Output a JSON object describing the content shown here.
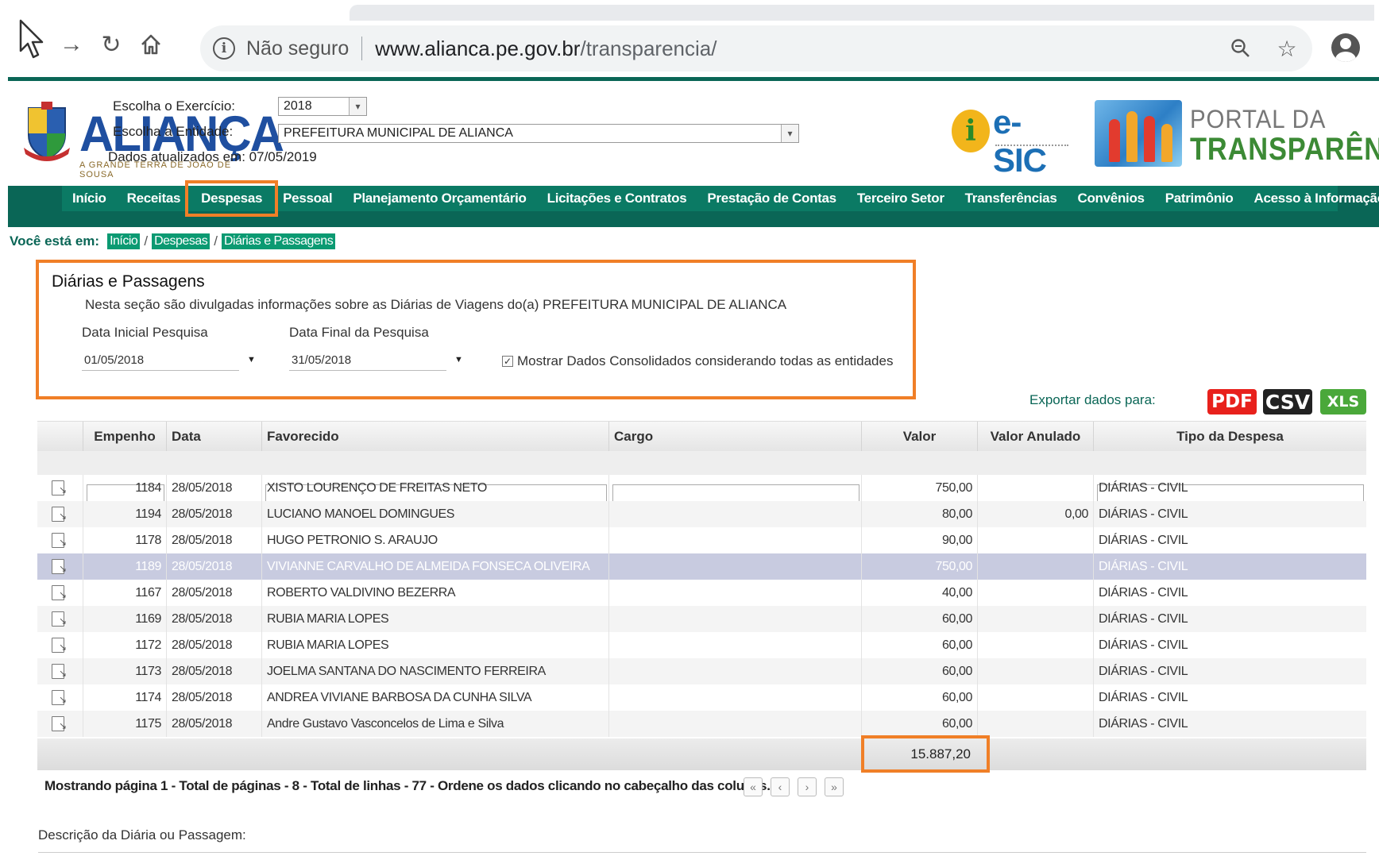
{
  "browser": {
    "security_label": "Não seguro",
    "url_host": "www.alianca.pe.gov.br",
    "url_path": "/transparencia/"
  },
  "header": {
    "logo_text": "ALIANÇA",
    "logo_sub": "A GRANDE TERRA DE JOAO DE SOUSA",
    "exercicio_label": "Escolha o Exercício:",
    "exercicio_value": "2018",
    "entidade_label": "Escolha a Entidade:",
    "entidade_value": "PREFEITURA MUNICIPAL DE ALIANCA",
    "updated_label": "Dados atualizados em: 07/05/2019",
    "esic_text": "e-SIC",
    "portal_line1": "PORTAL DA",
    "portal_line2": "TRANSPARÊNCIA"
  },
  "nav": [
    "Início",
    "Receitas",
    "Despesas",
    "Pessoal",
    "Planejamento Orçamentário",
    "Licitações e Contratos",
    "Prestação de Contas",
    "Terceiro Setor",
    "Transferências",
    "Convênios",
    "Patrimônio",
    "Acesso à Informação"
  ],
  "breadcrumb": {
    "lead": "Você está em:",
    "items": [
      "Início",
      "Despesas",
      "Diárias e Passagens"
    ]
  },
  "section": {
    "title": "Diárias e Passagens",
    "description": "Nesta seção são divulgadas informações sobre as Diárias de Viagens do(a) PREFEITURA MUNICIPAL DE ALIANCA",
    "date_start_label": "Data Inicial Pesquisa",
    "date_start_value": "01/05/2018",
    "date_end_label": "Data Final da Pesquisa",
    "date_end_value": "31/05/2018",
    "consolidated_label": "Mostrar Dados Consolidados considerando todas as entidades",
    "consolidated_checked": true
  },
  "export": {
    "label": "Exportar dados para:",
    "pdf": "PDF",
    "csv": "CSV",
    "xls": "XLS",
    "pdf_color": "#e8211c",
    "csv_color": "#222222",
    "xls_color": "#4aa83a"
  },
  "table": {
    "columns": [
      "Empenho",
      "Data",
      "Favorecido",
      "Cargo",
      "Valor",
      "Valor Anulado",
      "Tipo da Despesa"
    ],
    "rows": [
      {
        "empenho": "1184",
        "data": "28/05/2018",
        "favorecido": "XISTO LOURENÇO DE FREITAS NETO",
        "cargo": "",
        "valor": "750,00",
        "anulado": "",
        "tipo": "DIÁRIAS - CIVIL"
      },
      {
        "empenho": "1194",
        "data": "28/05/2018",
        "favorecido": "LUCIANO MANOEL DOMINGUES",
        "cargo": "",
        "valor": "80,00",
        "anulado": "0,00",
        "tipo": "DIÁRIAS - CIVIL"
      },
      {
        "empenho": "1178",
        "data": "28/05/2018",
        "favorecido": "HUGO PETRONIO S. ARAUJO",
        "cargo": "",
        "valor": "90,00",
        "anulado": "",
        "tipo": "DIÁRIAS - CIVIL"
      },
      {
        "empenho": "1189",
        "data": "28/05/2018",
        "favorecido": "VIVIANNE CARVALHO DE ALMEIDA FONSECA OLIVEIRA",
        "cargo": "",
        "valor": "750,00",
        "anulado": "",
        "tipo": "DIÁRIAS - CIVIL",
        "selected": true
      },
      {
        "empenho": "1167",
        "data": "28/05/2018",
        "favorecido": "ROBERTO VALDIVINO BEZERRA",
        "cargo": "",
        "valor": "40,00",
        "anulado": "",
        "tipo": "DIÁRIAS - CIVIL"
      },
      {
        "empenho": "1169",
        "data": "28/05/2018",
        "favorecido": "RUBIA MARIA LOPES",
        "cargo": "",
        "valor": "60,00",
        "anulado": "",
        "tipo": "DIÁRIAS - CIVIL"
      },
      {
        "empenho": "1172",
        "data": "28/05/2018",
        "favorecido": "RUBIA MARIA LOPES",
        "cargo": "",
        "valor": "60,00",
        "anulado": "",
        "tipo": "DIÁRIAS - CIVIL"
      },
      {
        "empenho": "1173",
        "data": "28/05/2018",
        "favorecido": "JOELMA SANTANA DO NASCIMENTO FERREIRA",
        "cargo": "",
        "valor": "60,00",
        "anulado": "",
        "tipo": "DIÁRIAS - CIVIL"
      },
      {
        "empenho": "1174",
        "data": "28/05/2018",
        "favorecido": "ANDREA VIVIANE BARBOSA DA CUNHA SILVA",
        "cargo": "",
        "valor": "60,00",
        "anulado": "",
        "tipo": "DIÁRIAS - CIVIL"
      },
      {
        "empenho": "1175",
        "data": "28/05/2018",
        "favorecido": "Andre Gustavo Vasconcelos de Lima e Silva",
        "cargo": "",
        "valor": "60,00",
        "anulado": "",
        "tipo": "DIÁRIAS - CIVIL"
      }
    ],
    "total": "15.887,20"
  },
  "pager": {
    "text": "Mostrando página 1 - Total de páginas - 8 - Total de linhas - 77 - Ordene os dados clicando no cabeçalho das colunas.",
    "first": "«",
    "prev": "‹",
    "next": "›",
    "last": "»"
  },
  "description_label": "Descrição da Diária ou Passagem:",
  "colors": {
    "teal": "#0a6656",
    "highlight": "#f07f27"
  }
}
